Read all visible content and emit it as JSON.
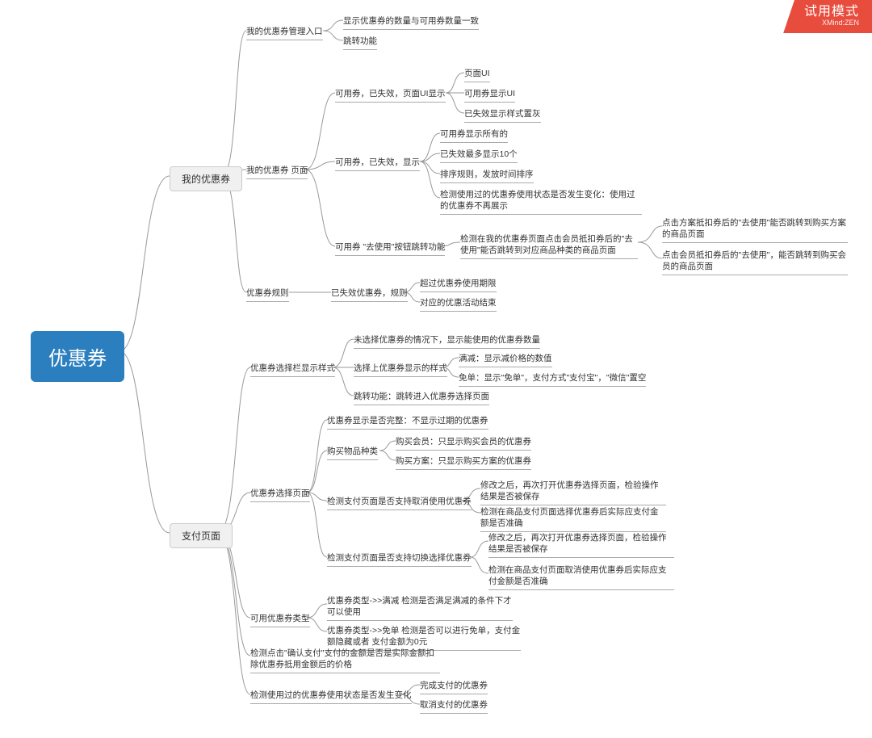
{
  "watermark": {
    "title": "试用模式",
    "sub": "XMind:ZEN"
  },
  "root": "优惠券",
  "b1": "我的优惠券",
  "b2": "支付页面",
  "n_entry": "我的优惠券管理入口",
  "n_entry_c1": "显示优惠券的数量与可用券数量一致",
  "n_entry_c2": "跳转功能",
  "n_page": "我的优惠券 页面",
  "n_page_ui": "可用券，已失效，页面UI显示",
  "n_page_ui_c1": "页面UI",
  "n_page_ui_c2": "可用券显示UI",
  "n_page_ui_c3": "已失效显示样式置灰",
  "n_page_show": "可用券，已失效，显示",
  "n_page_show_c1": "可用券显示所有的",
  "n_page_show_c2": "已失效最多显示10个",
  "n_page_show_c3": "排序规则，发放时间排序",
  "n_page_show_c4": "检测使用过的优惠券使用状态是否发生变化：使用过的优惠券不再展示",
  "n_page_go": "可用券 \"去使用\"按钮跳转功能",
  "n_page_go_c1": "检测在我的优惠券页面点击会员抵扣券后的\"去使用\"能否跳转到对应商品种类的商品页面",
  "n_page_go_c1_a": "点击方案抵扣券后的\"去使用\"能否跳转到购买方案的商品页面",
  "n_page_go_c1_b": "点击会员抵扣券后的\"去使用\"，能否跳转到购买会员的商品页面",
  "n_rule": "优惠券规则",
  "n_rule_exp": "已失效优惠券，规则",
  "n_rule_exp_c1": "超过优惠券使用期限",
  "n_rule_exp_c2": "对应的优惠活动结束",
  "p_bar": "优惠券选择栏显示样式",
  "p_bar_c1": "未选择优惠券的情况下，显示能使用的优惠券数量",
  "p_bar_sel": "选择上优惠券显示的样式",
  "p_bar_sel_c1": "满减：显示减价格的数值",
  "p_bar_sel_c2": "免单：显示\"免单\"，支付方式\"支付宝\"，\"微信\"置空",
  "p_bar_c3": "跳转功能：跳转进入优惠券选择页面",
  "p_page": "优惠券选择页面",
  "p_page_c1": "优惠券显示是否完整：不显示过期的优惠券",
  "p_page_kind": "购买物品种类",
  "p_page_kind_c1": "购买会员：只显示购买会员的优惠券",
  "p_page_kind_c2": "购买方案：只显示购买方案的优惠券",
  "p_page_cancel": "检测支付页面是否支持取消使用优惠券",
  "p_page_cancel_c1": "修改之后，再次打开优惠券选择页面，检验操作结果是否被保存",
  "p_page_cancel_c2": "检测在商品支付页面选择优惠券后实际应支付金额是否准确",
  "p_page_switch": "检测支付页面是否支持切换选择优惠券",
  "p_page_switch_c1": "修改之后，再次打开优惠券选择页面，检验操作结果是否被保存",
  "p_page_switch_c2": "检测在商品支付页面取消使用优惠券后实际应支付金额是否准确",
  "p_type": "可用优惠券类型",
  "p_type_c1": "优惠券类型->>满减 检测是否满足满减的条件下才可以使用",
  "p_type_c2": "优惠券类型->>免单 检测是否可以进行免单，支付金额隐藏或者 支付金额为0元",
  "p_confirm": "检测点击\"确认支付\"支付的金额是否是实际金额扣除优惠券抵用金额后的价格",
  "p_used": "检测使用过的优惠券使用状态是否发生变化",
  "p_used_c1": "完成支付的优惠券",
  "p_used_c2": "取消支付的优惠券"
}
